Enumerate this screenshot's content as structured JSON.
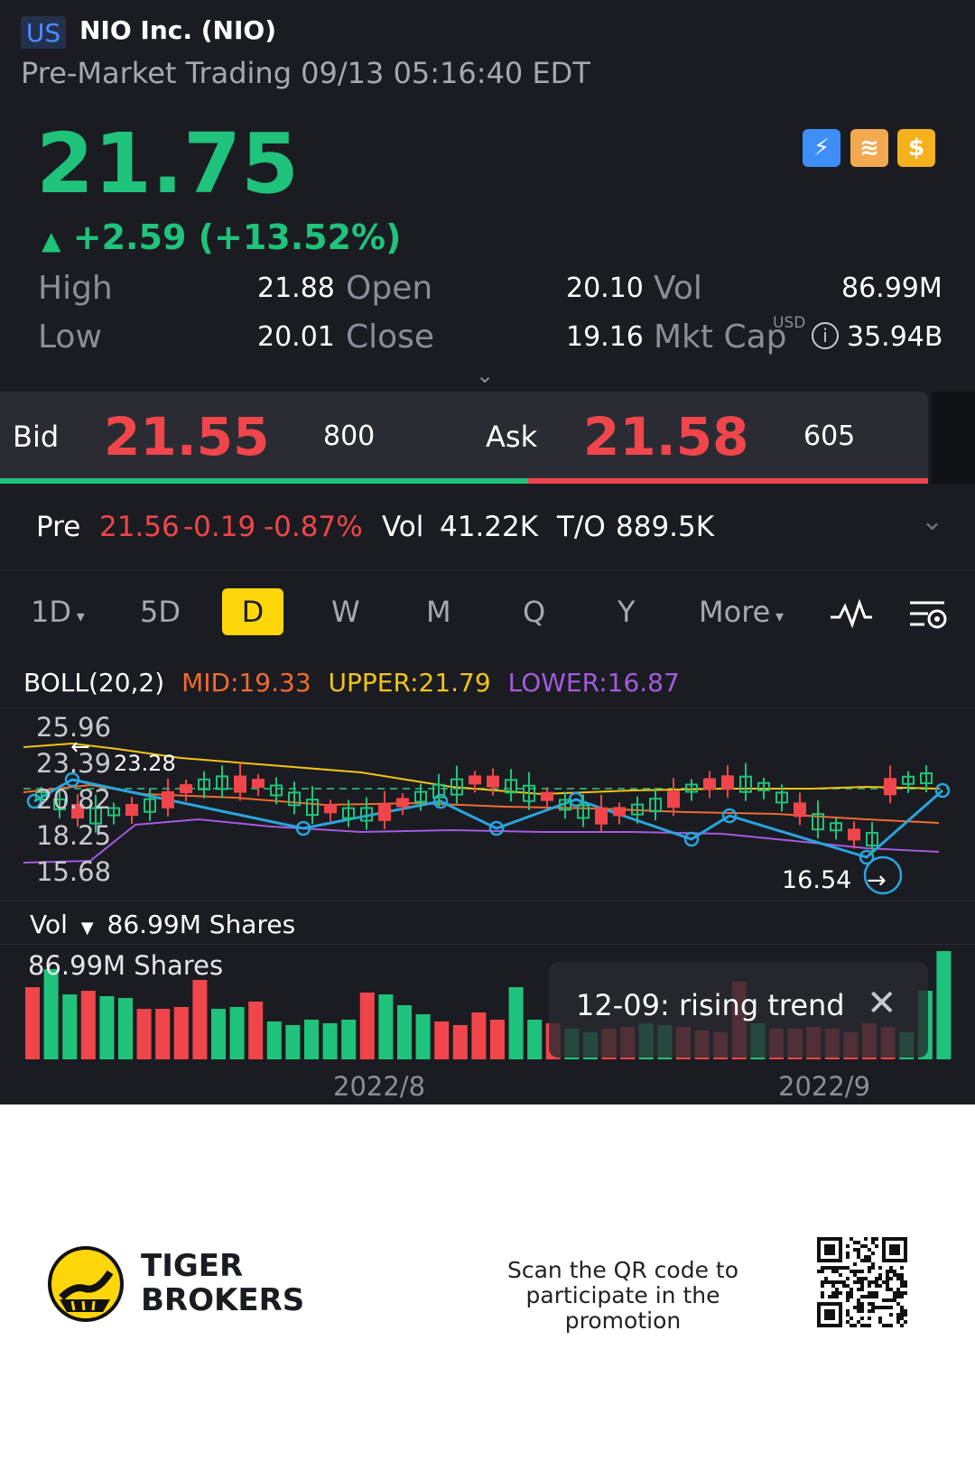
{
  "header": {
    "market": "US",
    "title": "NIO Inc. (NIO)",
    "subtitle": "Pre-Market Trading 09/13 05:16:40 EDT"
  },
  "quote": {
    "price": "21.75",
    "change": "+2.59 (+13.52%)",
    "high_label": "High",
    "high": "21.88",
    "low_label": "Low",
    "low": "20.01",
    "open_label": "Open",
    "open": "20.10",
    "close_label": "Close",
    "close": "19.16",
    "vol_label": "Vol",
    "vol": "86.99M",
    "mktcap_label": "Mkt Cap",
    "mktcap_currency": "USD",
    "mktcap": "35.94B"
  },
  "tools": [
    "lightning-icon",
    "stack-icon",
    "dollar-icon"
  ],
  "bid_ask": {
    "bid_label": "Bid",
    "bid": "21.55",
    "bid_qty": "800",
    "ask_label": "Ask",
    "ask": "21.58",
    "ask_qty": "605",
    "bid_share": 0.57
  },
  "premarket": {
    "label": "Pre",
    "price": "21.56",
    "change": "-0.19",
    "pct": "-0.87%",
    "vol_label": "Vol",
    "vol": "41.22K",
    "to_label": "T/O",
    "to": "889.5K"
  },
  "periods": [
    "1D",
    "5D",
    "D",
    "W",
    "M",
    "Q",
    "Y",
    "More"
  ],
  "active_period": "D",
  "indicator": {
    "name": "BOLL(20,2)",
    "mid": "MID:19.33",
    "upper": "UPPER:21.79",
    "lower": "LOWER:16.87"
  },
  "price_axis": [
    "25.96",
    "23.39",
    "20.82",
    "18.25",
    "15.68"
  ],
  "annotations": {
    "high_mark": "23.28",
    "low_mark": "16.54"
  },
  "volume": {
    "title": "Vol",
    "value": "86.99M Shares",
    "axis_label": "86.99M Shares"
  },
  "tooltip": "12-09: rising trend",
  "date_labels": [
    "2022/8",
    "2022/9"
  ],
  "colors": {
    "up": "#1fc37b",
    "down": "#f0464b",
    "accent": "#ffd60a",
    "mid": "#f26b2f",
    "upper": "#f0c419",
    "lower": "#a45be0",
    "trend": "#29a5e0"
  },
  "footer": {
    "brand_line1": "TIGER",
    "brand_line2": "BROKERS",
    "message_line1": "Scan the QR code to",
    "message_line2": "participate in the promotion"
  }
}
